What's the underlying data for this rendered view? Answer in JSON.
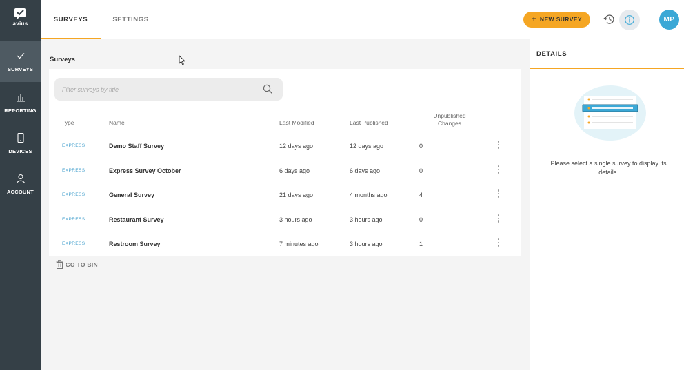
{
  "app": {
    "logo_text": "avius"
  },
  "sidebar": {
    "items": [
      {
        "label": "SURVEYS",
        "icon": "check-icon",
        "active": true
      },
      {
        "label": "REPORTING",
        "icon": "bar-chart-icon",
        "active": false
      },
      {
        "label": "DEVICES",
        "icon": "tablet-icon",
        "active": false
      },
      {
        "label": "ACCOUNT",
        "icon": "user-icon",
        "active": false
      }
    ]
  },
  "topbar": {
    "tabs": [
      {
        "label": "SURVEYS",
        "active": true
      },
      {
        "label": "SETTINGS",
        "active": false
      }
    ],
    "new_survey_label": "NEW SURVEY",
    "avatar_initials": "MP"
  },
  "main": {
    "section_title": "Surveys",
    "search": {
      "placeholder": "Filter surveys by title",
      "value": ""
    },
    "columns": {
      "type": "Type",
      "name": "Name",
      "last_modified": "Last Modified",
      "last_published": "Last Published",
      "unpublished_line1": "Unpublished",
      "unpublished_line2": "Changes"
    },
    "rows": [
      {
        "type": "EXPRESS",
        "name": "Demo Staff Survey",
        "last_modified": "12 days ago",
        "last_published": "12 days ago",
        "unpublished_changes": "0"
      },
      {
        "type": "EXPRESS",
        "name": "Express Survey October",
        "last_modified": "6 days ago",
        "last_published": "6 days ago",
        "unpublished_changes": "0"
      },
      {
        "type": "EXPRESS",
        "name": "General Survey",
        "last_modified": "21 days ago",
        "last_published": "4 months ago",
        "unpublished_changes": "4"
      },
      {
        "type": "EXPRESS",
        "name": "Restaurant Survey",
        "last_modified": "3 hours ago",
        "last_published": "3 hours ago",
        "unpublished_changes": "0"
      },
      {
        "type": "EXPRESS",
        "name": "Restroom Survey",
        "last_modified": "7 minutes ago",
        "last_published": "3 hours ago",
        "unpublished_changes": "1"
      }
    ],
    "go_to_bin_label": "GO TO BIN"
  },
  "details": {
    "tab_label": "DETAILS",
    "empty_message": "Please select a single survey to display its details."
  },
  "colors": {
    "sidebar_bg": "#354047",
    "accent_orange": "#f5a623",
    "express_blue": "#4aa3cf",
    "avatar_blue": "#3ba8d6"
  }
}
